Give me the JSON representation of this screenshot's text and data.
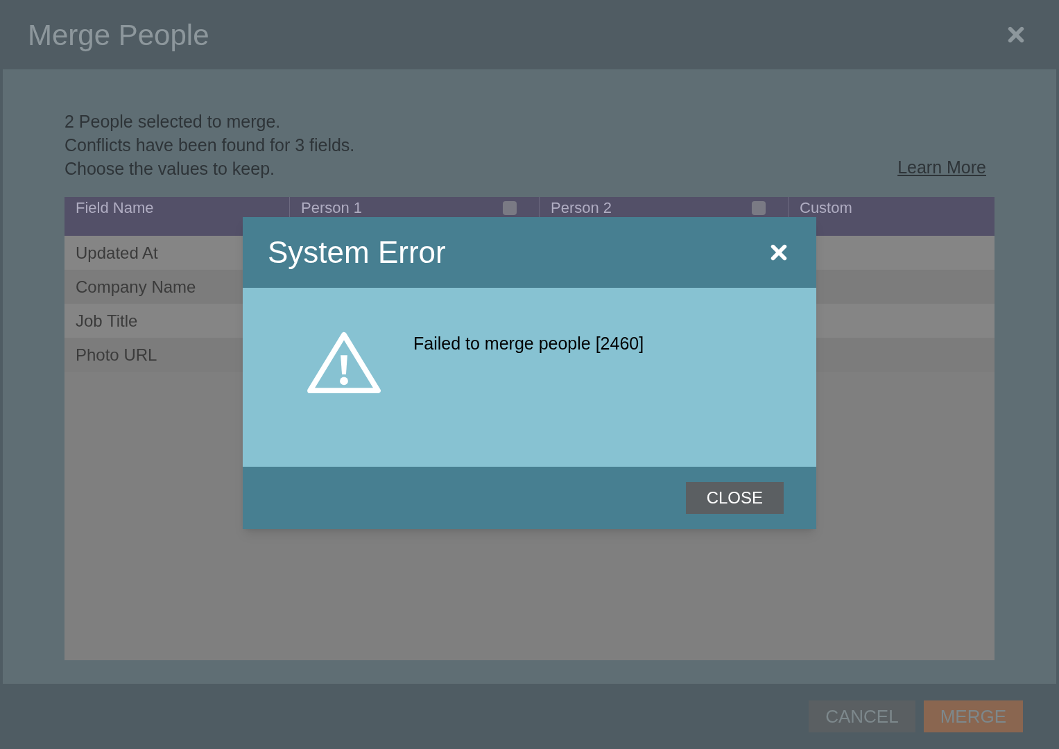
{
  "dialog": {
    "title": "Merge People",
    "intro": [
      "2 People selected to merge.",
      "Conflicts have been found for 3 fields.",
      "Choose the values to keep."
    ],
    "learn_more": "Learn More"
  },
  "table": {
    "columns": [
      {
        "label": "Field Name",
        "kind": "plain"
      },
      {
        "label": "Person 1",
        "kind": "checkbox",
        "checked": false
      },
      {
        "label": "Person 2",
        "kind": "checkbox",
        "checked": false
      },
      {
        "label": "Custom",
        "kind": "plain"
      }
    ],
    "rows": [
      "Updated At",
      "Company Name",
      "Job Title",
      "Photo URL"
    ]
  },
  "buttons": [
    {
      "label": "CANCEL",
      "kind": "secondary"
    },
    {
      "label": "MERGE",
      "kind": "primary"
    }
  ],
  "error": {
    "title": "System Error",
    "message": "Failed to merge people [2460]",
    "button": "CLOSE"
  }
}
